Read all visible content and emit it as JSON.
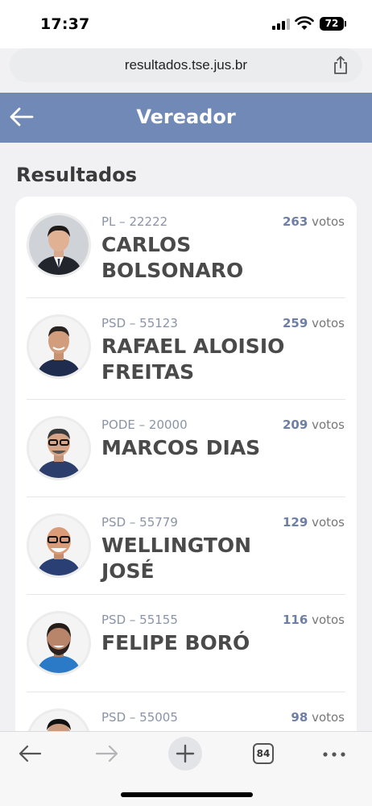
{
  "status_bar": {
    "time": "17:37",
    "battery": "72"
  },
  "browser": {
    "url": "resultados.tse.jus.br",
    "tabs_count": "84"
  },
  "header": {
    "title": "Vereador"
  },
  "section": {
    "title": "Resultados"
  },
  "candidates": [
    {
      "party": "PL – 22222",
      "votes_num": "263",
      "votes_label": " votos",
      "name": "CARLOS BOLSONARO"
    },
    {
      "party": "PSD – 55123",
      "votes_num": "259",
      "votes_label": " votos",
      "name": "RAFAEL ALOISIO FREITAS"
    },
    {
      "party": "PODE – 20000",
      "votes_num": "209",
      "votes_label": " votos",
      "name": "MARCOS DIAS"
    },
    {
      "party": "PSD – 55779",
      "votes_num": "129",
      "votes_label": " votos",
      "name": "WELLINGTON JOSÉ"
    },
    {
      "party": "PSD – 55155",
      "votes_num": "116",
      "votes_label": " votos",
      "name": "FELIPE BORÓ"
    },
    {
      "party": "PSD – 55005",
      "votes_num": "98",
      "votes_label": " votos",
      "name": ""
    }
  ],
  "colors": {
    "header": "#7189b6",
    "votes_accent": "#6e7fa6"
  }
}
